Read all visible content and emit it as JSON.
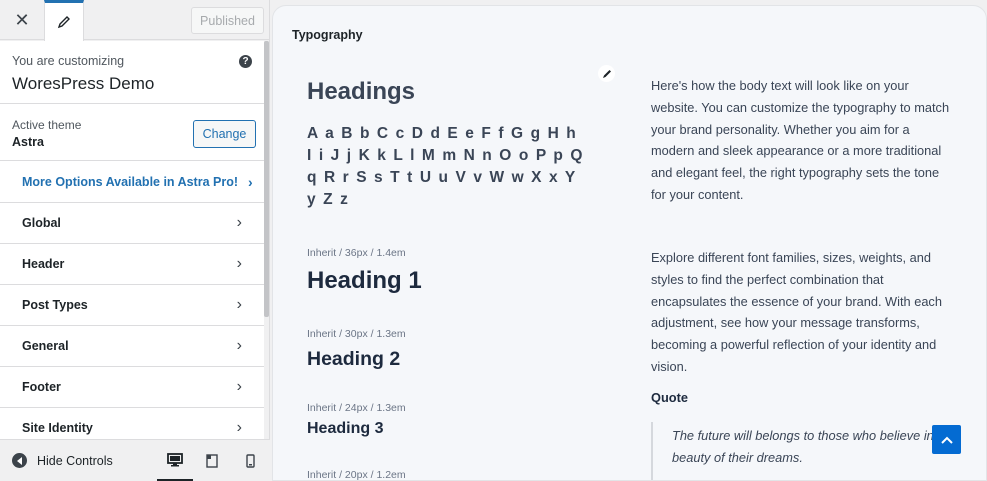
{
  "topbar": {
    "close_glyph": "✕",
    "published_label": "Published"
  },
  "customizing": {
    "label": "You are customizing",
    "title": "WoresPress Demo",
    "help_glyph": "?"
  },
  "theme": {
    "label": "Active theme",
    "name": "Astra",
    "change_label": "Change"
  },
  "pro_link": {
    "label": "More Options Available in Astra Pro!",
    "chevron": "›"
  },
  "nav": {
    "items": [
      {
        "label": "Global",
        "chevron": "›"
      },
      {
        "label": "Header",
        "chevron": "›"
      },
      {
        "label": "Post Types",
        "chevron": "›"
      },
      {
        "label": "General",
        "chevron": "›"
      },
      {
        "label": "Footer",
        "chevron": "›"
      },
      {
        "label": "Site Identity",
        "chevron": "›"
      }
    ]
  },
  "bottom": {
    "hide_label": "Hide Controls",
    "active_device": "desktop"
  },
  "preview": {
    "section_title": "Typography",
    "headings_title": "Headings",
    "alphabet": "A a B b C c D d E e F f G g H h I i J j K k L l M m N n O o P p Q q R r S s T t U u V v W w X x Y y Z z",
    "h1_meta": "Inherit / 36px / 1.4em",
    "h1_text": "Heading 1",
    "h2_meta": "Inherit / 30px / 1.3em",
    "h2_text": "Heading 2",
    "h3_meta": "Inherit / 24px / 1.3em",
    "h3_text": "Heading 3",
    "h4_meta": "Inherit / 20px / 1.2em",
    "para1": "Here's how the body text will look like on your website. You can customize the typography to match your brand personality. Whether you aim for a modern and sleek appearance or a more traditional and elegant feel, the right typography sets the tone for your content.",
    "para2": "Explore different font families, sizes, weights, and styles to find the perfect combination that encapsulates the essence of your brand. With each adjustment, see how your message transforms, becoming a powerful reflection of your identity and vision.",
    "quote_label": "Quote",
    "quote_text": "The future will belongs to those who believe in the beauty of their dreams."
  },
  "colors": {
    "accent": "#2271b1",
    "scroll_top": "#046bd2"
  }
}
